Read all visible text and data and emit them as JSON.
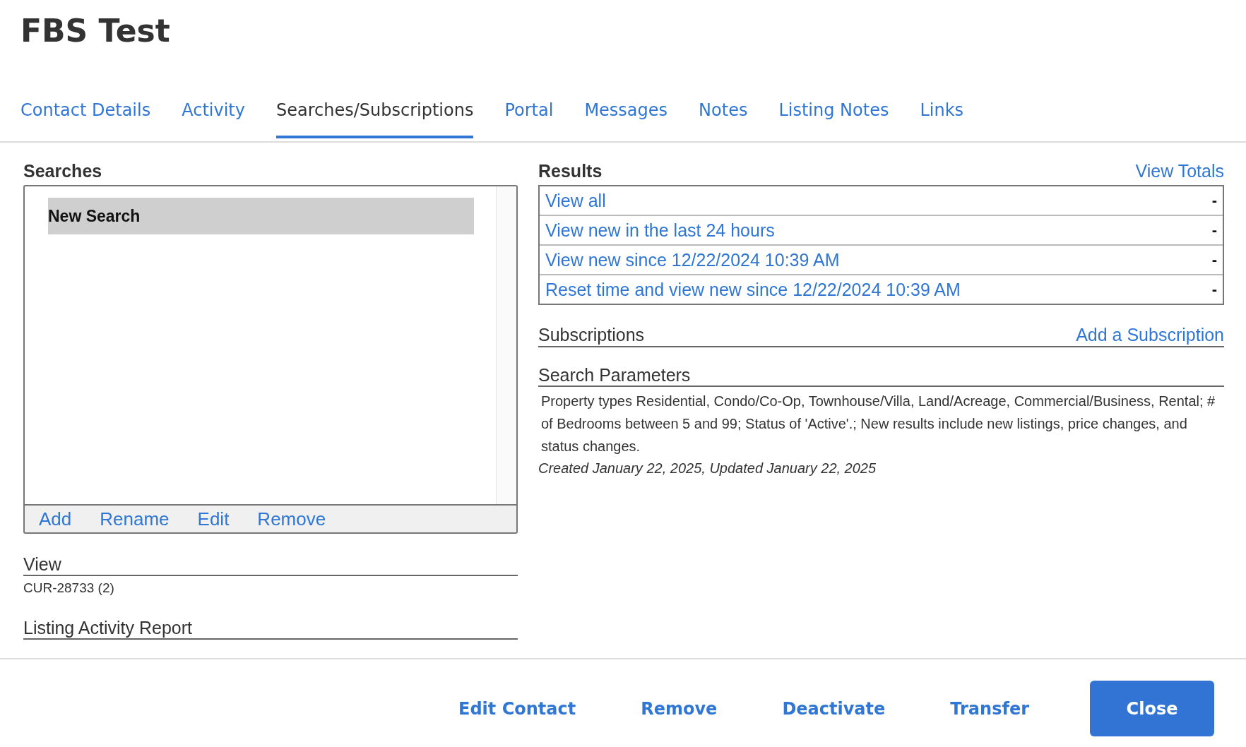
{
  "title": "FBS Test",
  "tabs": [
    {
      "label": "Contact Details",
      "selected": false
    },
    {
      "label": "Activity",
      "selected": false
    },
    {
      "label": "Searches/Subscriptions",
      "selected": true
    },
    {
      "label": "Portal",
      "selected": false
    },
    {
      "label": "Messages",
      "selected": false
    },
    {
      "label": "Notes",
      "selected": false
    },
    {
      "label": "Listing Notes",
      "selected": false
    },
    {
      "label": "Links",
      "selected": false
    }
  ],
  "searches": {
    "heading": "Searches",
    "items": [
      {
        "label": "New Search",
        "selected": true
      }
    ],
    "actions": [
      "Add",
      "Rename",
      "Edit",
      "Remove"
    ]
  },
  "view": {
    "heading": "View",
    "value": "CUR-28733 (2)"
  },
  "listing_activity_report": {
    "heading": "Listing Activity Report"
  },
  "results": {
    "heading": "Results",
    "link": "View Totals",
    "rows": [
      {
        "label": "View all",
        "count": "-"
      },
      {
        "label": "View new in the last 24 hours",
        "count": "-"
      },
      {
        "label": "View new since 12/22/2024 10:39 AM",
        "count": "-"
      },
      {
        "label": "Reset time and view new since 12/22/2024 10:39 AM",
        "count": "-"
      }
    ]
  },
  "subscriptions": {
    "heading": "Subscriptions",
    "link": "Add a Subscription"
  },
  "search_parameters": {
    "heading": "Search Parameters",
    "description": "Property types Residential, Condo/Co-Op, Townhouse/Villa, Land/Acreage, Commercial/Business, Rental; # of Bedrooms between 5 and 99; Status of 'Active'.; New results include new listings, price changes, and status changes.",
    "dates": "Created January 22, 2025, Updated January 22, 2025"
  },
  "footer_buttons": [
    {
      "label": "Edit Contact",
      "kind": "link"
    },
    {
      "label": "Remove",
      "kind": "link"
    },
    {
      "label": "Deactivate",
      "kind": "link"
    },
    {
      "label": "Transfer",
      "kind": "link"
    },
    {
      "label": "Close",
      "kind": "primary"
    }
  ]
}
